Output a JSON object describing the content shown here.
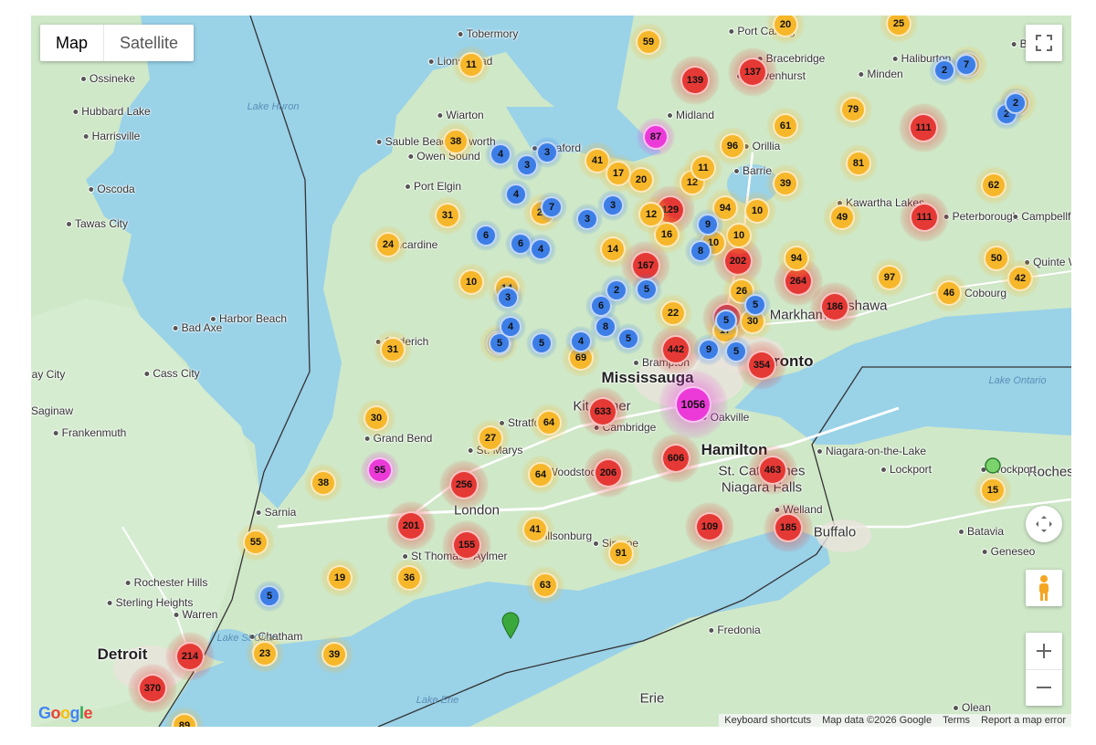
{
  "map_type": {
    "map_label": "Map",
    "satellite_label": "Satellite"
  },
  "footer": {
    "keyboard": "Keyboard shortcuts",
    "mapdata": "Map data ©2026 Google",
    "terms": "Terms",
    "report": "Report a map error"
  },
  "logo_text": "Google",
  "colors": {
    "red": "#e53935",
    "orange": "#f6b72b",
    "blue": "#3d7ee6",
    "magenta": "#ec3ad8",
    "land": "#cfe8c8",
    "water": "#9ad2e8"
  },
  "labels": [
    {
      "text": "Mississauga",
      "kind": "big"
    },
    {
      "text": "Toronto",
      "kind": "big"
    },
    {
      "text": "Hamilton",
      "kind": "big"
    },
    {
      "text": "Detroit",
      "kind": "big"
    },
    {
      "text": "London",
      "kind": "city"
    },
    {
      "text": "Kitchener",
      "kind": "city"
    },
    {
      "text": "Buffalo",
      "kind": "city"
    },
    {
      "text": "Markham",
      "kind": "city"
    },
    {
      "text": "Oshawa",
      "kind": "city"
    },
    {
      "text": "Niagara Falls",
      "kind": "city"
    },
    {
      "text": "St. Catharines",
      "kind": "city"
    },
    {
      "text": "Rochester",
      "kind": "city"
    },
    {
      "text": "Erie",
      "kind": "city"
    },
    {
      "text": "Sarnia",
      "kind": "small"
    },
    {
      "text": "Owen Sound",
      "kind": "small"
    },
    {
      "text": "Midland",
      "kind": "small"
    },
    {
      "text": "Barrie",
      "kind": "small"
    },
    {
      "text": "Orillia",
      "kind": "small"
    },
    {
      "text": "Peterborough",
      "kind": "small"
    },
    {
      "text": "Kawartha Lakes",
      "kind": "small"
    },
    {
      "text": "Cobourg",
      "kind": "small"
    },
    {
      "text": "Cambridge",
      "kind": "small"
    },
    {
      "text": "Stratford",
      "kind": "small"
    },
    {
      "text": "St. Marys",
      "kind": "small"
    },
    {
      "text": "Woodstock",
      "kind": "small"
    },
    {
      "text": "St Thomas",
      "kind": "small"
    },
    {
      "text": "Aylmer",
      "kind": "small"
    },
    {
      "text": "Tillsonburg",
      "kind": "small"
    },
    {
      "text": "Simcoe",
      "kind": "small"
    },
    {
      "text": "Welland",
      "kind": "small"
    },
    {
      "text": "Grand Bend",
      "kind": "small"
    },
    {
      "text": "Goderich",
      "kind": "small"
    },
    {
      "text": "Kincardine",
      "kind": "small"
    },
    {
      "text": "Port Elgin",
      "kind": "small"
    },
    {
      "text": "Wiarton",
      "kind": "small"
    },
    {
      "text": "Hepworth",
      "kind": "small"
    },
    {
      "text": "Sauble Beach",
      "kind": "small"
    },
    {
      "text": "Meaford",
      "kind": "small"
    },
    {
      "text": "Tobermory",
      "kind": "small"
    },
    {
      "text": "Lions Head",
      "kind": "small"
    },
    {
      "text": "Bracebridge",
      "kind": "small"
    },
    {
      "text": "Gravenhurst",
      "kind": "small"
    },
    {
      "text": "Port Carling",
      "kind": "small"
    },
    {
      "text": "Haliburton",
      "kind": "small"
    },
    {
      "text": "Minden",
      "kind": "small"
    },
    {
      "text": "Bancroft",
      "kind": "small"
    },
    {
      "text": "Campbellford",
      "kind": "small"
    },
    {
      "text": "Quinte West",
      "kind": "small"
    },
    {
      "text": "Ossineke",
      "kind": "small"
    },
    {
      "text": "Hubbard Lake",
      "kind": "small"
    },
    {
      "text": "Harrisville",
      "kind": "small"
    },
    {
      "text": "Oscoda",
      "kind": "small"
    },
    {
      "text": "Tawas City",
      "kind": "small"
    },
    {
      "text": "Bad Axe",
      "kind": "small"
    },
    {
      "text": "Harbor Beach",
      "kind": "small"
    },
    {
      "text": "Cass City",
      "kind": "small"
    },
    {
      "text": "Bay City",
      "kind": "small"
    },
    {
      "text": "Saginaw",
      "kind": "small"
    },
    {
      "text": "Frankenmuth",
      "kind": "small"
    },
    {
      "text": "Rochester Hills",
      "kind": "small"
    },
    {
      "text": "Sterling Heights",
      "kind": "small"
    },
    {
      "text": "Warren",
      "kind": "small"
    },
    {
      "text": "Chatham",
      "kind": "small"
    },
    {
      "text": "Niagara-on-the-Lake",
      "kind": "small"
    },
    {
      "text": "Lockport",
      "kind": "small"
    },
    {
      "text": "Brockport",
      "kind": "small"
    },
    {
      "text": "Batavia",
      "kind": "small"
    },
    {
      "text": "Geneseo",
      "kind": "small"
    },
    {
      "text": "Fredonia",
      "kind": "small"
    },
    {
      "text": "Olean",
      "kind": "small"
    },
    {
      "text": "Brampton",
      "kind": "small"
    },
    {
      "text": "Oakville",
      "kind": "small"
    },
    {
      "text": "Lake Huron",
      "kind": "water"
    },
    {
      "text": "Lake Ontario",
      "kind": "water"
    },
    {
      "text": "Lake Erie",
      "kind": "water"
    },
    {
      "text": "Lake St Clair",
      "kind": "water"
    }
  ],
  "clusters": [
    {
      "n": "1056",
      "c": "magenta",
      "s": 3
    },
    {
      "n": "633",
      "c": "red",
      "s": 2
    },
    {
      "n": "606",
      "c": "red",
      "s": 2
    },
    {
      "n": "463",
      "c": "red",
      "s": 2
    },
    {
      "n": "442",
      "c": "red",
      "s": 2
    },
    {
      "n": "370",
      "c": "red",
      "s": 2
    },
    {
      "n": "354",
      "c": "red",
      "s": 2
    },
    {
      "n": "317",
      "c": "red",
      "s": 2
    },
    {
      "n": "264",
      "c": "red",
      "s": 2
    },
    {
      "n": "256",
      "c": "red",
      "s": 2
    },
    {
      "n": "214",
      "c": "red",
      "s": 2
    },
    {
      "n": "206",
      "c": "red",
      "s": 2
    },
    {
      "n": "202",
      "c": "red",
      "s": 2
    },
    {
      "n": "201",
      "c": "red",
      "s": 2
    },
    {
      "n": "186",
      "c": "red",
      "s": 2
    },
    {
      "n": "185",
      "c": "red",
      "s": 2
    },
    {
      "n": "167",
      "c": "red",
      "s": 2
    },
    {
      "n": "155",
      "c": "red",
      "s": 2
    },
    {
      "n": "139",
      "c": "red",
      "s": 2
    },
    {
      "n": "137",
      "c": "red",
      "s": 2
    },
    {
      "n": "129",
      "c": "red",
      "s": 2
    },
    {
      "n": "111",
      "c": "red",
      "s": 2
    },
    {
      "n": "111",
      "c": "red",
      "s": 2
    },
    {
      "n": "109",
      "c": "red",
      "s": 2
    },
    {
      "n": "97",
      "c": "orange",
      "s": 1
    },
    {
      "n": "96",
      "c": "orange",
      "s": 1
    },
    {
      "n": "95",
      "c": "magenta",
      "s": 1
    },
    {
      "n": "94",
      "c": "orange",
      "s": 1
    },
    {
      "n": "94",
      "c": "orange",
      "s": 1
    },
    {
      "n": "91",
      "c": "orange",
      "s": 1
    },
    {
      "n": "89",
      "c": "orange",
      "s": 1
    },
    {
      "n": "87",
      "c": "magenta",
      "s": 1
    },
    {
      "n": "81",
      "c": "orange",
      "s": 1
    },
    {
      "n": "79",
      "c": "orange",
      "s": 1
    },
    {
      "n": "69",
      "c": "orange",
      "s": 1
    },
    {
      "n": "64",
      "c": "orange",
      "s": 1
    },
    {
      "n": "64",
      "c": "orange",
      "s": 1
    },
    {
      "n": "63",
      "c": "orange",
      "s": 1
    },
    {
      "n": "62",
      "c": "orange",
      "s": 1
    },
    {
      "n": "61",
      "c": "orange",
      "s": 1
    },
    {
      "n": "59",
      "c": "orange",
      "s": 1
    },
    {
      "n": "55",
      "c": "orange",
      "s": 1
    },
    {
      "n": "50",
      "c": "orange",
      "s": 1
    },
    {
      "n": "49",
      "c": "orange",
      "s": 1
    },
    {
      "n": "46",
      "c": "orange",
      "s": 1
    },
    {
      "n": "42",
      "c": "orange",
      "s": 1
    },
    {
      "n": "41",
      "c": "orange",
      "s": 1
    },
    {
      "n": "41",
      "c": "orange",
      "s": 1
    },
    {
      "n": "39",
      "c": "orange",
      "s": 1
    },
    {
      "n": "39",
      "c": "orange",
      "s": 1
    },
    {
      "n": "38",
      "c": "orange",
      "s": 1
    },
    {
      "n": "38",
      "c": "orange",
      "s": 1
    },
    {
      "n": "36",
      "c": "orange",
      "s": 1
    },
    {
      "n": "31",
      "c": "orange",
      "s": 1
    },
    {
      "n": "31",
      "c": "orange",
      "s": 1
    },
    {
      "n": "30",
      "c": "orange",
      "s": 1
    },
    {
      "n": "30",
      "c": "orange",
      "s": 1
    },
    {
      "n": "27",
      "c": "orange",
      "s": 1
    },
    {
      "n": "27",
      "c": "orange",
      "s": 1
    },
    {
      "n": "26",
      "c": "orange",
      "s": 1
    },
    {
      "n": "25",
      "c": "orange",
      "s": 1
    },
    {
      "n": "24",
      "c": "orange",
      "s": 1
    },
    {
      "n": "23",
      "c": "orange",
      "s": 1
    },
    {
      "n": "22",
      "c": "orange",
      "s": 1
    },
    {
      "n": "20",
      "c": "orange",
      "s": 1
    },
    {
      "n": "20",
      "c": "orange",
      "s": 1
    },
    {
      "n": "19",
      "c": "orange",
      "s": 1
    },
    {
      "n": "17",
      "c": "orange",
      "s": 1
    },
    {
      "n": "17",
      "c": "orange",
      "s": 1
    },
    {
      "n": "16",
      "c": "orange",
      "s": 1
    },
    {
      "n": "15",
      "c": "orange",
      "s": 1
    },
    {
      "n": "15",
      "c": "orange",
      "s": 1
    },
    {
      "n": "14",
      "c": "orange",
      "s": 1
    },
    {
      "n": "14",
      "c": "orange",
      "s": 1
    },
    {
      "n": "13",
      "c": "orange",
      "s": 1
    },
    {
      "n": "12",
      "c": "orange",
      "s": 1
    },
    {
      "n": "12",
      "c": "orange",
      "s": 1
    },
    {
      "n": "11",
      "c": "orange",
      "s": 1
    },
    {
      "n": "11",
      "c": "orange",
      "s": 1
    },
    {
      "n": "10",
      "c": "orange",
      "s": 1
    },
    {
      "n": "10",
      "c": "orange",
      "s": 1
    },
    {
      "n": "10",
      "c": "orange",
      "s": 1
    },
    {
      "n": "10",
      "c": "orange",
      "s": 1
    },
    {
      "n": "10",
      "c": "orange",
      "s": 1
    },
    {
      "n": "9",
      "c": "blue",
      "s": 0
    },
    {
      "n": "9",
      "c": "blue",
      "s": 0
    },
    {
      "n": "8",
      "c": "blue",
      "s": 0
    },
    {
      "n": "8",
      "c": "blue",
      "s": 0
    },
    {
      "n": "7",
      "c": "blue",
      "s": 0
    },
    {
      "n": "7",
      "c": "blue",
      "s": 0
    },
    {
      "n": "6",
      "c": "blue",
      "s": 0
    },
    {
      "n": "6",
      "c": "blue",
      "s": 0
    },
    {
      "n": "6",
      "c": "blue",
      "s": 0
    },
    {
      "n": "5",
      "c": "blue",
      "s": 0
    },
    {
      "n": "5",
      "c": "blue",
      "s": 0
    },
    {
      "n": "5",
      "c": "blue",
      "s": 0
    },
    {
      "n": "5",
      "c": "blue",
      "s": 0
    },
    {
      "n": "5",
      "c": "blue",
      "s": 0
    },
    {
      "n": "5",
      "c": "blue",
      "s": 0
    },
    {
      "n": "5",
      "c": "blue",
      "s": 0
    },
    {
      "n": "5",
      "c": "blue",
      "s": 0
    },
    {
      "n": "4",
      "c": "blue",
      "s": 0
    },
    {
      "n": "4",
      "c": "blue",
      "s": 0
    },
    {
      "n": "4",
      "c": "blue",
      "s": 0
    },
    {
      "n": "4",
      "c": "blue",
      "s": 0
    },
    {
      "n": "4",
      "c": "blue",
      "s": 0
    },
    {
      "n": "3",
      "c": "blue",
      "s": 0
    },
    {
      "n": "3",
      "c": "blue",
      "s": 0
    },
    {
      "n": "3",
      "c": "blue",
      "s": 0
    },
    {
      "n": "3",
      "c": "blue",
      "s": 0
    },
    {
      "n": "3",
      "c": "blue",
      "s": 0
    },
    {
      "n": "2",
      "c": "blue",
      "s": 0
    },
    {
      "n": "2",
      "c": "blue",
      "s": 0
    },
    {
      "n": "2",
      "c": "blue",
      "s": 0
    },
    {
      "n": "2",
      "c": "blue",
      "s": 0
    },
    {
      "n": "2",
      "c": "blue",
      "s": 0
    },
    {
      "n": "2",
      "c": "blue",
      "s": 0
    },
    {
      "n": "2",
      "c": "blue",
      "s": 0
    },
    {
      "n": "15",
      "c": "orange",
      "s": 1
    },
    {
      "n": "80",
      "c": "orange",
      "s": 1
    },
    {
      "n": "10",
      "c": "orange",
      "s": 1
    },
    {
      "n": "6",
      "c": "blue",
      "s": 0
    },
    {
      "n": "14",
      "c": "orange",
      "s": 1
    }
  ],
  "markers": [
    {
      "name": "green-pin",
      "color": "#3aa83a"
    },
    {
      "name": "green-dot",
      "color": "#7bd36b"
    }
  ]
}
